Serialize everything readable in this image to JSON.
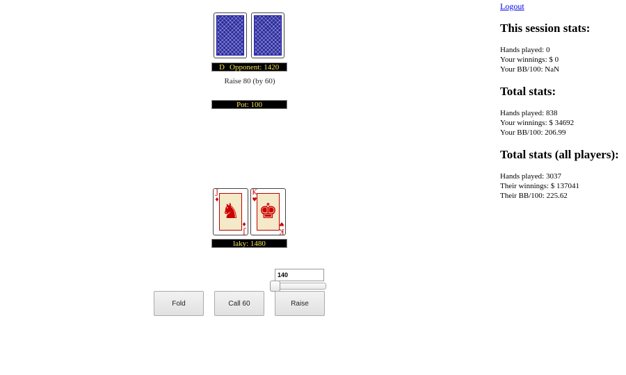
{
  "opponent": {
    "dealer_marker": "D",
    "label": "Opponent: 1420",
    "last_action": "Raise 80 (by 60)"
  },
  "pot": {
    "label": "Pot: 100"
  },
  "player": {
    "label": "laky: 1480",
    "cards": [
      {
        "rank": "J",
        "suit": "♦",
        "figure": "♞"
      },
      {
        "rank": "K",
        "suit": "♥",
        "figure": "♚"
      }
    ]
  },
  "controls": {
    "fold_label": "Fold",
    "call_label": "Call 60",
    "raise_label": "Raise",
    "raise_amount": "140"
  },
  "sidebar": {
    "logout": "Logout",
    "session": {
      "title": "This session stats:",
      "hands": "Hands played: 0",
      "winnings": "Your winnings: $ 0",
      "bb": "Your BB/100: NaN"
    },
    "total": {
      "title": "Total stats:",
      "hands": "Hands played: 838",
      "winnings": "Your winnings: $ 34692",
      "bb": "Your BB/100: 206.99"
    },
    "all_players": {
      "title": "Total stats (all players):",
      "hands": "Hands played: 3037",
      "winnings": "Their winnings: $ 137041",
      "bb": "Their BB/100: 225.62"
    }
  },
  "colors": {
    "label_text": "#f6e25a",
    "label_bg": "#000000",
    "card_back": "#2a2aa0",
    "red_suit": "#cc0000",
    "link": "#0000ee"
  },
  "icons": {
    "card_back": "card-back-icon",
    "suit_diamond": "diamond-icon",
    "suit_heart": "heart-icon"
  }
}
